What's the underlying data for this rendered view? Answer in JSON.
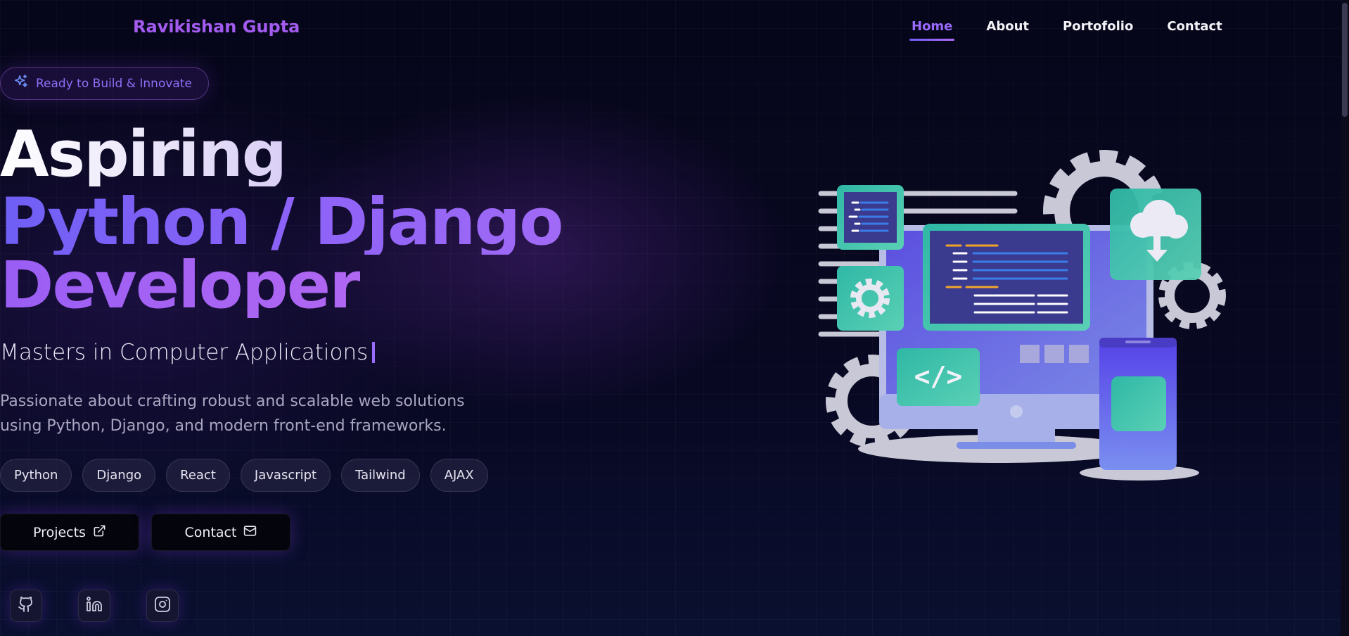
{
  "brand": "Ravikishan Gupta",
  "nav": [
    {
      "label": "Home",
      "active": true
    },
    {
      "label": "About",
      "active": false
    },
    {
      "label": "Portofolio",
      "active": false
    },
    {
      "label": "Contact",
      "active": false
    }
  ],
  "badge": {
    "label": "Ready to Build & Innovate",
    "icon": "sparkles-icon"
  },
  "headline": {
    "line1": "Aspiring",
    "line2": "Python / Django",
    "line3": "Developer"
  },
  "subtitle": "Masters in Computer Applications",
  "description": "Passionate about crafting robust and scalable web solutions using Python, Django, and modern front-end frameworks.",
  "tags": [
    "Python",
    "Django",
    "React",
    "Javascript",
    "Tailwind",
    "AJAX"
  ],
  "buttons": {
    "projects": {
      "label": "Projects",
      "icon": "external-link-icon"
    },
    "contact": {
      "label": "Contact",
      "icon": "mail-icon"
    }
  },
  "socials": [
    {
      "name": "github",
      "icon": "github-icon"
    },
    {
      "name": "linkedin",
      "icon": "linkedin-icon"
    },
    {
      "name": "instagram",
      "icon": "instagram-icon"
    }
  ],
  "colors": {
    "accent": "#9a6bff",
    "brand": "#a35bf0",
    "background": "#070718",
    "teal": "#2fb8a6"
  }
}
